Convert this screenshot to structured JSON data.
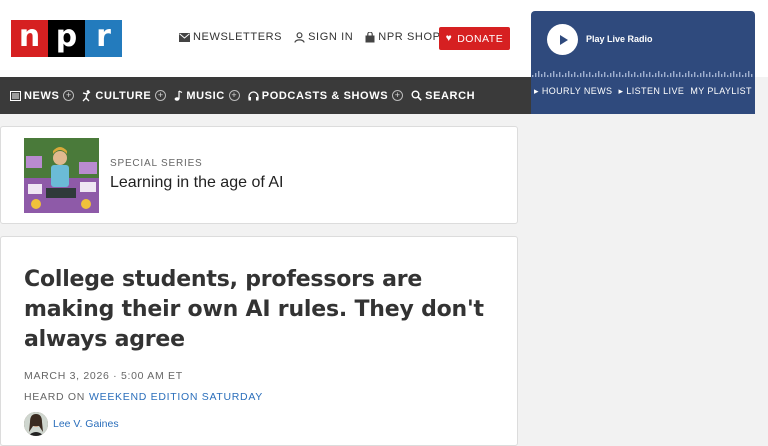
{
  "logo": {
    "letters": [
      "n",
      "p",
      "r"
    ],
    "colors": [
      "#d62021",
      "#000000",
      "#237bbd"
    ]
  },
  "header": {
    "links": [
      {
        "label": "NEWSLETTERS",
        "icon": "envelope-icon"
      },
      {
        "label": "SIGN IN",
        "icon": "user-icon"
      },
      {
        "label": "NPR SHOP",
        "icon": "shopping-bag-icon"
      }
    ],
    "donate_label": "DONATE",
    "donate_color": "#d62021"
  },
  "player": {
    "label": "Play Live Radio",
    "links": [
      "HOURLY NEWS",
      "LISTEN LIVE",
      "MY PLAYLIST"
    ],
    "background": "#2f4a7d"
  },
  "nav": {
    "items": [
      {
        "label": "NEWS",
        "icon": "newspaper-icon",
        "expandable": true
      },
      {
        "label": "CULTURE",
        "icon": "dancer-icon",
        "expandable": true
      },
      {
        "label": "MUSIC",
        "icon": "music-note-icon",
        "expandable": true
      },
      {
        "label": "PODCASTS & SHOWS",
        "icon": "headphones-icon",
        "expandable": true
      },
      {
        "label": "SEARCH",
        "icon": "search-icon",
        "expandable": false
      }
    ],
    "background": "#3a3a3a"
  },
  "series": {
    "label": "SPECIAL SERIES",
    "title": "Learning in the age of AI"
  },
  "article": {
    "headline": "College students, professors are making their own AI rules. They don't always agree",
    "dateline": "MARCH 3, 2026 · 5:00 AM ET",
    "heard_on_prefix": "HEARD ON",
    "heard_on_show": "WEEKEND EDITION SATURDAY",
    "author": "Lee V. Gaines"
  }
}
